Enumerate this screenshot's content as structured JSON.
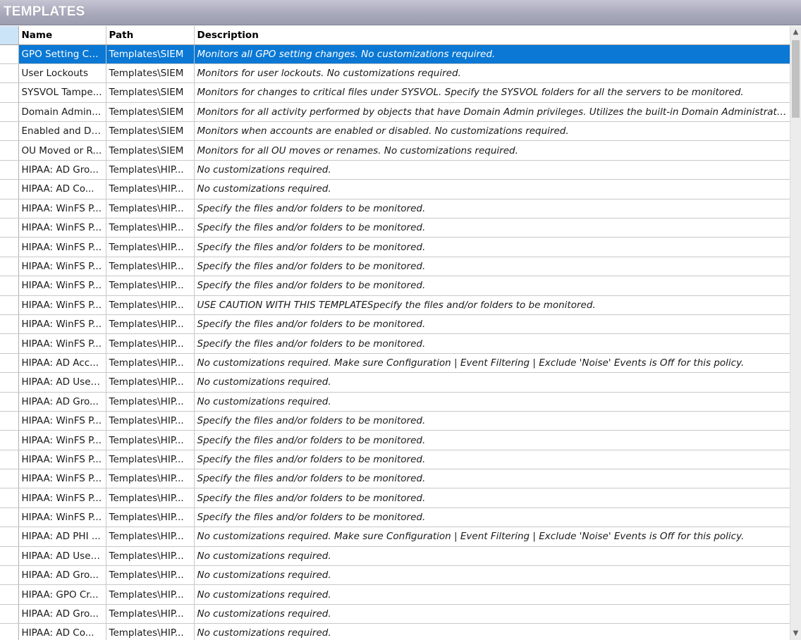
{
  "window": {
    "title": "TEMPLATES"
  },
  "columns": {
    "name": "Name",
    "path": "Path",
    "description": "Description"
  },
  "colors": {
    "selection": "#0a78d4",
    "header_selector": "#cce4f7"
  },
  "icons": {
    "scroll_up": "chevron-up-icon",
    "scroll_down": "chevron-down-icon"
  },
  "rows": [
    {
      "name": "GPO Setting Ch...",
      "path": "Templates\\SIEM",
      "description": "Monitors all GPO setting changes. No customizations required.",
      "selected": true
    },
    {
      "name": "User Lockouts",
      "path": "Templates\\SIEM",
      "description": "Monitors for user lockouts. No customizations required."
    },
    {
      "name": "SYSVOL Tampe...",
      "path": "Templates\\SIEM",
      "description": "Monitors for changes to critical files under SYSVOL.  Specify the SYSVOL folders for all the servers to be monitored."
    },
    {
      "name": "Domain Admin...",
      "path": "Templates\\SIEM",
      "description": "Monitors for all activity performed by objects that have Domain Admin privileges. Utilizes the built-in Domain Administrators –..."
    },
    {
      "name": "Enabled and Di...",
      "path": "Templates\\SIEM",
      "description": "Monitors when accounts are enabled or disabled. No customizations required."
    },
    {
      "name": "OU Moved or R...",
      "path": "Templates\\SIEM",
      "description": "Monitors for all OU moves or renames. No customizations required."
    },
    {
      "name": "HIPAA: AD Gro...",
      "path": "Templates\\HIP...",
      "description": "No customizations required."
    },
    {
      "name": "HIPAA: AD Co...",
      "path": "Templates\\HIP...",
      "description": "No customizations required."
    },
    {
      "name": "HIPAA: WinFS P...",
      "path": "Templates\\HIP...",
      "description": "Specify the files and/or folders to be monitored."
    },
    {
      "name": "HIPAA: WinFS P...",
      "path": "Templates\\HIP...",
      "description": "Specify the files and/or folders to be monitored."
    },
    {
      "name": "HIPAA: WinFS P...",
      "path": "Templates\\HIP...",
      "description": "Specify the files and/or folders to be monitored."
    },
    {
      "name": "HIPAA: WinFS P...",
      "path": "Templates\\HIP...",
      "description": "Specify the files and/or folders to be monitored."
    },
    {
      "name": "HIPAA: WinFS P...",
      "path": "Templates\\HIP...",
      "description": "Specify the files and/or folders to be monitored."
    },
    {
      "name": "HIPAA: WinFS P...",
      "path": "Templates\\HIP...",
      "description": "USE CAUTION WITH THIS TEMPLATESpecify the files and/or folders to be monitored."
    },
    {
      "name": "HIPAA: WinFS P...",
      "path": "Templates\\HIP...",
      "description": "Specify the files and/or folders to be monitored."
    },
    {
      "name": "HIPAA: WinFS P...",
      "path": "Templates\\HIP...",
      "description": "Specify the files and/or folders to be monitored."
    },
    {
      "name": "HIPAA: AD Acc...",
      "path": "Templates\\HIP...",
      "description": "No customizations required. Make sure Configuration | Event Filtering | Exclude 'Noise' Events is Off for this policy."
    },
    {
      "name": "HIPAA: AD User...",
      "path": "Templates\\HIP...",
      "description": "No customizations required."
    },
    {
      "name": "HIPAA: AD Gro...",
      "path": "Templates\\HIP...",
      "description": "No customizations required."
    },
    {
      "name": "HIPAA: WinFS P...",
      "path": "Templates\\HIP...",
      "description": "Specify the files and/or folders to be monitored."
    },
    {
      "name": "HIPAA: WinFS P...",
      "path": "Templates\\HIP...",
      "description": "Specify the files and/or folders to be monitored."
    },
    {
      "name": "HIPAA: WinFS P...",
      "path": "Templates\\HIP...",
      "description": "Specify the files and/or folders to be monitored."
    },
    {
      "name": "HIPAA: WinFS P...",
      "path": "Templates\\HIP...",
      "description": "Specify the files and/or folders to be monitored."
    },
    {
      "name": "HIPAA: WinFS P...",
      "path": "Templates\\HIP...",
      "description": "Specify the files and/or folders to be monitored."
    },
    {
      "name": "HIPAA: WinFS P...",
      "path": "Templates\\HIP...",
      "description": "Specify the files and/or folders to be monitored."
    },
    {
      "name": "HIPAA: AD PHI ...",
      "path": "Templates\\HIP...",
      "description": "No customizations required. Make sure Configuration | Event Filtering | Exclude 'Noise' Events is Off for this policy."
    },
    {
      "name": "HIPAA: AD User...",
      "path": "Templates\\HIP...",
      "description": "No customizations required."
    },
    {
      "name": "HIPAA: AD Gro...",
      "path": "Templates\\HIP...",
      "description": "No customizations required."
    },
    {
      "name": "HIPAA: GPO Cr...",
      "path": "Templates\\HIP...",
      "description": "No customizations required."
    },
    {
      "name": "HIPAA: AD Gro...",
      "path": "Templates\\HIP...",
      "description": "No customizations required."
    },
    {
      "name": "HIPAA: AD Co...",
      "path": "Templates\\HIP...",
      "description": "No customizations required."
    }
  ]
}
